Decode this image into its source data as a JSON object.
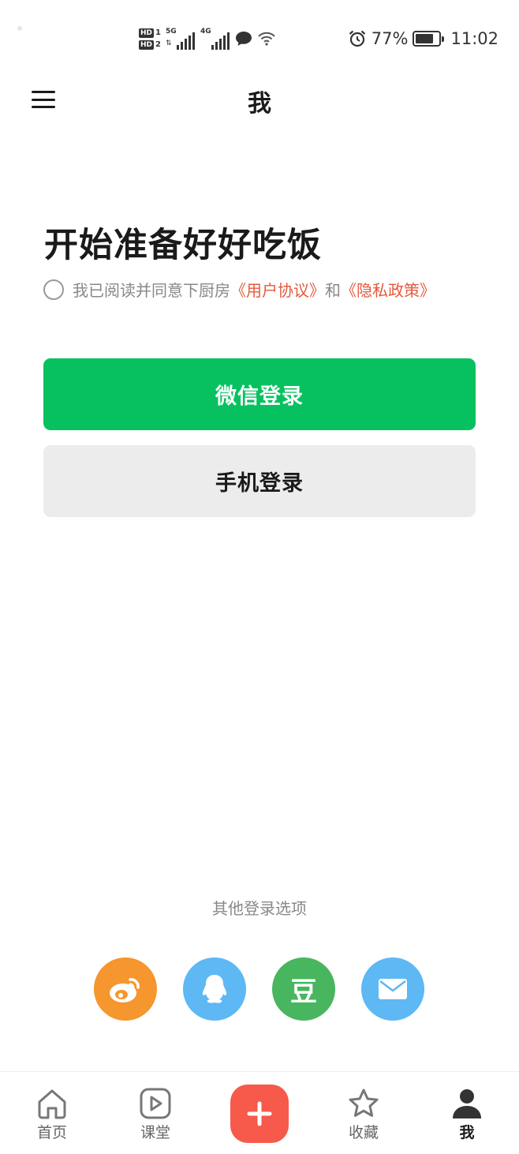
{
  "status_bar": {
    "hd1": "HD",
    "hd1_num": "1",
    "hd2": "HD",
    "hd2_num": "2",
    "net1": "5G",
    "net2": "4G",
    "battery_percent": "77%",
    "battery_level": 0.77,
    "time": "11:02"
  },
  "header": {
    "title": "我"
  },
  "main": {
    "headline": "开始准备好好吃饭",
    "agreement_prefix": "我已阅读并同意下厨房",
    "user_agreement": "《用户协议》",
    "agreement_and": "和",
    "privacy_policy": "《隐私政策》",
    "wechat_login": "微信登录",
    "phone_login": "手机登录"
  },
  "other_login": {
    "label": "其他登录选项",
    "douban_glyph": "豆"
  },
  "tabbar": {
    "home": "首页",
    "class": "课堂",
    "favorites": "收藏",
    "me": "我"
  },
  "colors": {
    "wechat_green": "#07c160",
    "link_red": "#e35a3d",
    "add_button": "#f7594a",
    "weibo_orange": "#f5962e",
    "qq_blue": "#5db8f4",
    "douban_green": "#48b65e",
    "mail_blue": "#5db8f4"
  },
  "icons": {
    "menu": "menu-icon",
    "weibo": "weibo-icon",
    "qq": "qq-icon",
    "douban": "douban-icon",
    "mail": "mail-icon",
    "home": "home-icon",
    "class": "play-icon",
    "add": "plus-icon",
    "favorites": "star-icon",
    "me": "person-icon"
  }
}
